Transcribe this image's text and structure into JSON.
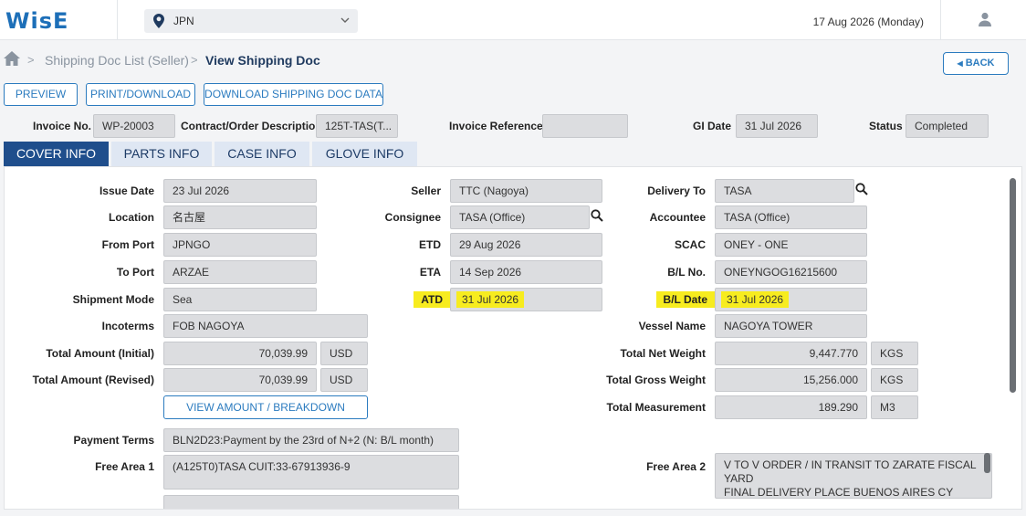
{
  "app": {
    "logo": "WisE"
  },
  "topbar": {
    "region": "JPN",
    "date": "17 Aug 2026 (Monday)"
  },
  "breadcrumb": {
    "items": [
      "Shipping Doc List (Seller)",
      "View Shipping Doc"
    ],
    "back_label": "BACK"
  },
  "actions": {
    "preview": "PREVIEW",
    "print": "PRINT/DOWNLOAD",
    "download": "DOWNLOAD SHIPPING DOC DATA"
  },
  "header": {
    "invoice_no_label": "Invoice No.",
    "invoice_no": "WP-20003",
    "contract_label": "Contract/Order Description",
    "contract": "125T-TAS(T...",
    "invoice_ref_label": "Invoice Reference",
    "invoice_ref": "",
    "gi_date_label": "GI Date",
    "gi_date": "31 Jul 2026",
    "status_label": "Status",
    "status": "Completed"
  },
  "tabs": [
    "COVER INFO",
    "PARTS INFO",
    "CASE INFO",
    "GLOVE INFO"
  ],
  "form": {
    "issue_date_label": "Issue Date",
    "issue_date": "23 Jul 2026",
    "location_label": "Location",
    "location": "名古屋",
    "from_port_label": "From Port",
    "from_port": "JPNGO",
    "to_port_label": "To Port",
    "to_port": "ARZAE",
    "shipment_mode_label": "Shipment Mode",
    "shipment_mode": "Sea",
    "incoterms_label": "Incoterms",
    "incoterms": "FOB NAGOYA",
    "total_initial_label": "Total Amount (Initial)",
    "total_initial": "70,039.99",
    "total_initial_cur": "USD",
    "total_revised_label": "Total Amount (Revised)",
    "total_revised": "70,039.99",
    "total_revised_cur": "USD",
    "view_amount_label": "VIEW AMOUNT / BREAKDOWN",
    "seller_label": "Seller",
    "seller": "TTC (Nagoya)",
    "consignee_label": "Consignee",
    "consignee": "TASA (Office)",
    "etd_label": "ETD",
    "etd": "29 Aug 2026",
    "eta_label": "ETA",
    "eta": "14 Sep 2026",
    "atd_label": "ATD",
    "atd": "31 Jul 2026",
    "delivery_to_label": "Delivery To",
    "delivery_to": "TASA",
    "accountee_label": "Accountee",
    "accountee": "TASA (Office)",
    "scac_label": "SCAC",
    "scac": "ONEY - ONE",
    "bl_no_label": "B/L No.",
    "bl_no": "ONEYNGOG16215600",
    "bl_date_label": "B/L Date",
    "bl_date": "31 Jul 2026",
    "vessel_label": "Vessel Name",
    "vessel": "NAGOYA TOWER",
    "net_weight_label": "Total Net Weight",
    "net_weight": "9,447.770",
    "net_weight_unit": "KGS",
    "gross_weight_label": "Total Gross Weight",
    "gross_weight": "15,256.000",
    "gross_weight_unit": "KGS",
    "measurement_label": "Total Measurement",
    "measurement": "189.290",
    "measurement_unit": "M3",
    "payment_terms_label": "Payment Terms",
    "payment_terms": "BLN2D23:Payment by the 23rd of N+2 (N: B/L month)",
    "free_area1_label": "Free Area 1",
    "free_area1": "(A125T0)TASA CUIT:33-67913936-9",
    "free_area2_label": "Free Area 2",
    "free_area2_lines": [
      "V TO V ORDER / IN TRANSIT TO ZARATE FISCAL",
      "YARD",
      "FINAL DELIVERY PLACE BUENOS AIRES CY"
    ]
  },
  "colors": {
    "accent": "#2b7bbf",
    "tab_active": "#1f4e8c",
    "highlight": "#f7ec1f"
  }
}
